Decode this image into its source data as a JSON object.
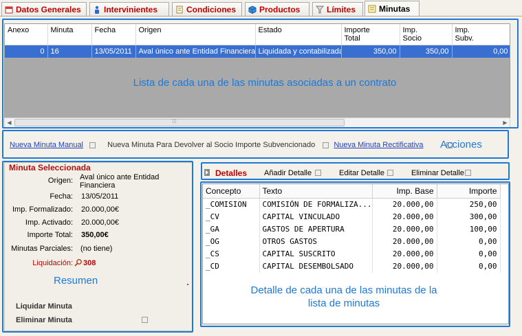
{
  "tabs": [
    {
      "label": "Datos Generales",
      "icon": "calendar-icon"
    },
    {
      "label": "Intervinientes",
      "icon": "person-icon"
    },
    {
      "label": "Condiciones",
      "icon": "document-icon"
    },
    {
      "label": "Productos",
      "icon": "cube-icon"
    },
    {
      "label": "Límites",
      "icon": "filter-icon"
    },
    {
      "label": "Minutas",
      "icon": "note-icon"
    }
  ],
  "grid": {
    "columns": [
      "Anexo",
      "Minuta",
      "Fecha",
      "Origen",
      "Estado",
      "Importe\nTotal",
      "Imp.\nSocio",
      "Imp.\nSubv."
    ],
    "rows": [
      [
        "0",
        "16",
        "13/05/2011",
        "Aval único ante Entidad Financiera",
        "Liquidada y contabilizada",
        "350,00",
        "350,00",
        "0,00"
      ]
    ]
  },
  "annotations": {
    "list": "Lista de cada una de las minutas asociadas a un contrato",
    "actions": "Acciones",
    "summary": "Resumen",
    "detail": "Detalle de cada una de las minutas de la lista de minutas"
  },
  "actions": {
    "manual": "Nueva Minuta Manual",
    "devolver": "Nueva Minuta Para Devolver al Socio Importe Subvencionado",
    "rectificativa": "Nueva Minuta Rectificativa"
  },
  "summary": {
    "title": "Minuta Seleccionada",
    "origen_label": "Origen:",
    "origen": "Aval único ante Entidad Financiera",
    "fecha_label": "Fecha:",
    "fecha": "13/05/2011",
    "formalizado_label": "Imp. Formalizado:",
    "formalizado": "20.000,00€",
    "activado_label": "Imp. Activado:",
    "activado": "20.000,00€",
    "total_label": "Importe Total:",
    "total": "350,00€",
    "parciales_label": "Minutas Parciales:",
    "parciales": "(no tiene)",
    "liquidacion_label": "Liquidación:",
    "liquidacion": "308",
    "liquidar": "Liquidar Minuta",
    "eliminar": "Eliminar Minuta"
  },
  "detail": {
    "title": "Detalles",
    "add": "Añadir Detalle",
    "edit": "Editar Detalle",
    "delete": "Eliminar Detalle",
    "columns": [
      "Concepto",
      "Texto",
      "Imp. Base",
      "Importe"
    ],
    "rows": [
      [
        "_COMISION",
        "COMISIÓN DE FORMALIZA...",
        "20.000,00",
        "250,00"
      ],
      [
        "_CV",
        "CAPITAL VINCULADO",
        "20.000,00",
        "300,00"
      ],
      [
        "_GA",
        "GASTOS DE APERTURA",
        "20.000,00",
        "100,00"
      ],
      [
        "_OG",
        "OTROS GASTOS",
        "20.000,00",
        "0,00"
      ],
      [
        "_CS",
        "CAPITAL SUSCRITO",
        "20.000,00",
        "0,00"
      ],
      [
        "_CD",
        "CAPITAL DESEMBOLSADO",
        "20.000,00",
        "0,00"
      ]
    ]
  },
  "colors": {
    "accent": "#1e78d7",
    "tab_text": "#c00000",
    "selection": "#3a6fd2"
  }
}
